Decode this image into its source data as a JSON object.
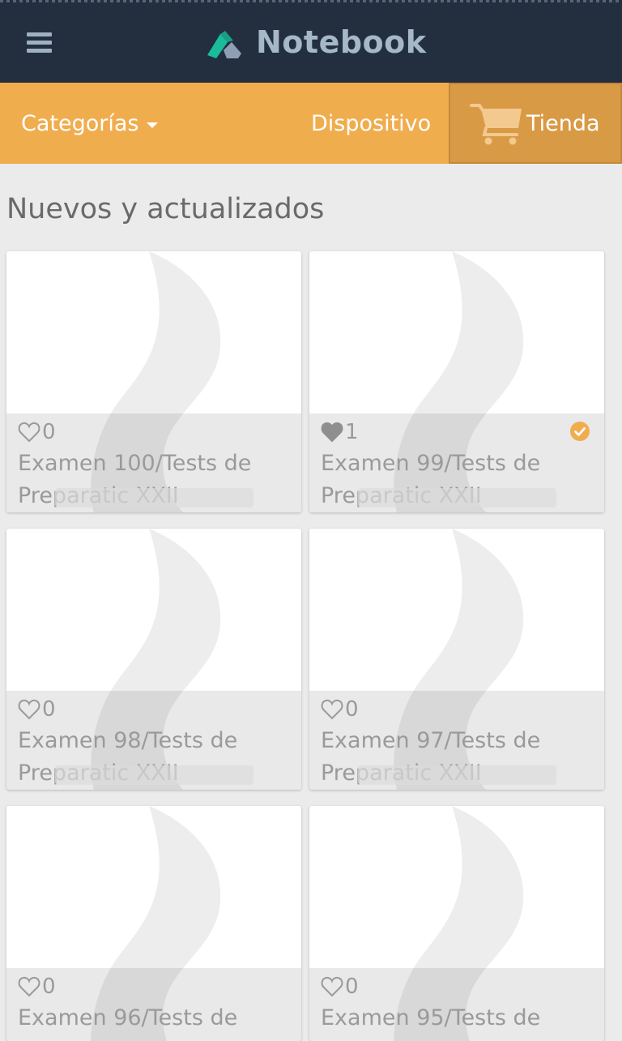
{
  "app": {
    "title": "Notebook"
  },
  "nav": {
    "categories_label": "Categorías",
    "device_label": "Dispositivo",
    "store_label": "Tienda"
  },
  "section": {
    "title": "Nuevos y actualizados"
  },
  "cards": [
    {
      "likes": "0",
      "liked": false,
      "owned": false,
      "title": "Examen 100/Tests de Preparatic XXII"
    },
    {
      "likes": "1",
      "liked": true,
      "owned": true,
      "title": "Examen 99/Tests de Preparatic XXII"
    },
    {
      "likes": "0",
      "liked": false,
      "owned": false,
      "title": "Examen 98/Tests de Preparatic XXII"
    },
    {
      "likes": "0",
      "liked": false,
      "owned": false,
      "title": "Examen 97/Tests de Preparatic XXII"
    },
    {
      "likes": "0",
      "liked": false,
      "owned": false,
      "title": "Examen 96/Tests de"
    },
    {
      "likes": "0",
      "liked": false,
      "owned": false,
      "title": "Examen 95/Tests de"
    }
  ],
  "icons": {
    "menu": "hamburger-menu-icon",
    "logo": "notebook-logo-icon",
    "caret": "caret-down-icon",
    "cart": "shopping-cart-icon",
    "like": "heart-icon",
    "owned": "check-circle-icon"
  },
  "colors": {
    "header_bg": "#232f3e",
    "category_bar_bg": "#f0ad4e",
    "store_tab_bg": "#d99a45",
    "accent": "#f0ad4e",
    "brand_green": "#1abc9c"
  }
}
